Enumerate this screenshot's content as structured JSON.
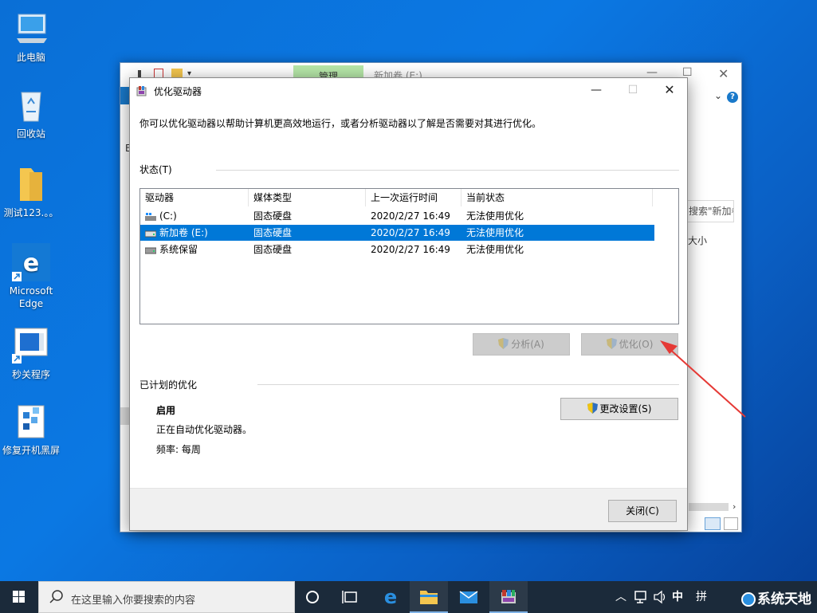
{
  "desktop": {
    "icons": [
      {
        "label": "此电脑"
      },
      {
        "label": "回收站"
      },
      {
        "label": "测试123.。。"
      },
      {
        "label": "Microsoft Edge"
      },
      {
        "label": "秒关程序"
      },
      {
        "label": "修复开机黑屏"
      }
    ]
  },
  "explorer": {
    "ribbon_tab_manage": "管理",
    "window_title": "新加卷 (E:)",
    "search_placeholder": "搜索\"新加卷 (E:)\"",
    "column_partial": "大小",
    "help_label": "?"
  },
  "dialog": {
    "title": "优化驱动器",
    "description": "你可以优化驱动器以帮助计算机更高效地运行，或者分析驱动器以了解是否需要对其进行优化。",
    "status_label": "状态(T)",
    "columns": [
      "驱动器",
      "媒体类型",
      "上一次运行时间",
      "当前状态"
    ],
    "drives": [
      {
        "name": "(C:)",
        "media": "固态硬盘",
        "last_run": "2020/2/27 16:49",
        "status": "无法使用优化",
        "selected": false
      },
      {
        "name": "新加卷 (E:)",
        "media": "固态硬盘",
        "last_run": "2020/2/27 16:49",
        "status": "无法使用优化",
        "selected": true
      },
      {
        "name": "系统保留",
        "media": "固态硬盘",
        "last_run": "2020/2/27 16:49",
        "status": "无法使用优化",
        "selected": false
      }
    ],
    "analyze_button": "分析(A)",
    "optimize_button": "优化(O)",
    "scheduled_label": "已计划的优化",
    "schedule_state": "启用",
    "schedule_desc": "正在自动优化驱动器。",
    "frequency": "频率: 每周",
    "change_settings_button": "更改设置(S)",
    "close_button": "关闭(C)"
  },
  "taskbar": {
    "search_placeholder": "在这里输入你要搜索的内容",
    "ime_label": "中",
    "ime_mode": "拼",
    "watermark": "系统天地"
  },
  "colors": {
    "selection": "#0078d7",
    "desktop": "#0b78e3",
    "arrow": "#e53935"
  }
}
